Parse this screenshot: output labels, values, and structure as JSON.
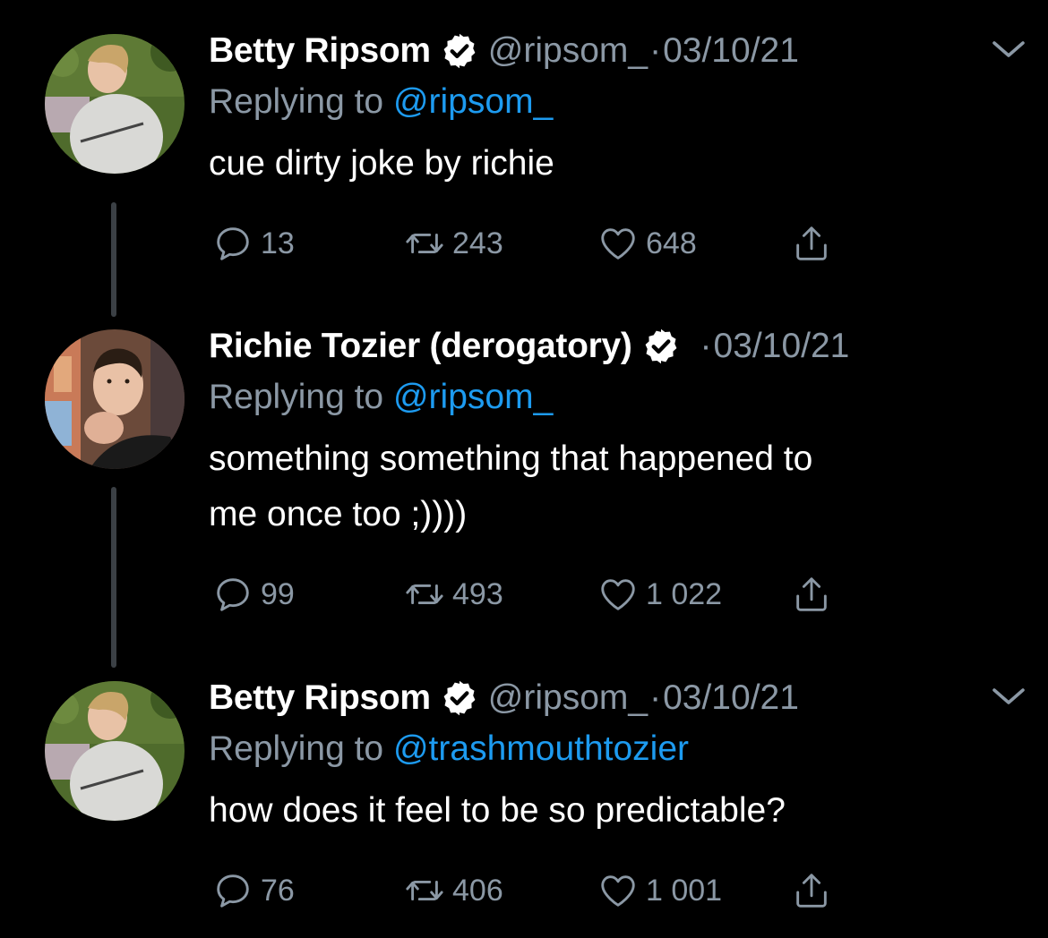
{
  "tweets": [
    {
      "display_name": "Betty Ripsom",
      "handle": "@ripsom_",
      "separator": "·",
      "date": "03/10/21",
      "replying_prefix": "Replying to",
      "replying_to": "@ripsom_",
      "text": "cue dirty joke by richie",
      "replies": "13",
      "retweets": "243",
      "likes": "648",
      "avatar": "woman-on-grass-avatar",
      "has_menu": true
    },
    {
      "display_name": "Richie Tozier (derogatory)",
      "handle": "",
      "separator": "·",
      "date": "03/10/21",
      "replying_prefix": "Replying to",
      "replying_to": "@ripsom_",
      "text": "something something that happened to\nme once too ;))))",
      "replies": "99",
      "retweets": "493",
      "likes": "1 022",
      "avatar": "man-yawning-avatar",
      "has_menu": false
    },
    {
      "display_name": "Betty Ripsom",
      "handle": "@ripsom_",
      "separator": "·",
      "date": "03/10/21",
      "replying_prefix": "Replying to",
      "replying_to": "@trashmouthtozier",
      "text": "how does it feel to be so predictable?",
      "replies": "76",
      "retweets": "406",
      "likes": "1 001",
      "avatar": "woman-on-grass-avatar",
      "has_menu": true
    }
  ],
  "colors": {
    "background": "#000000",
    "primary_text": "#ffffff",
    "secondary_text": "#8b98a5",
    "link": "#1d9bf0",
    "thread_line": "#3b4045"
  }
}
